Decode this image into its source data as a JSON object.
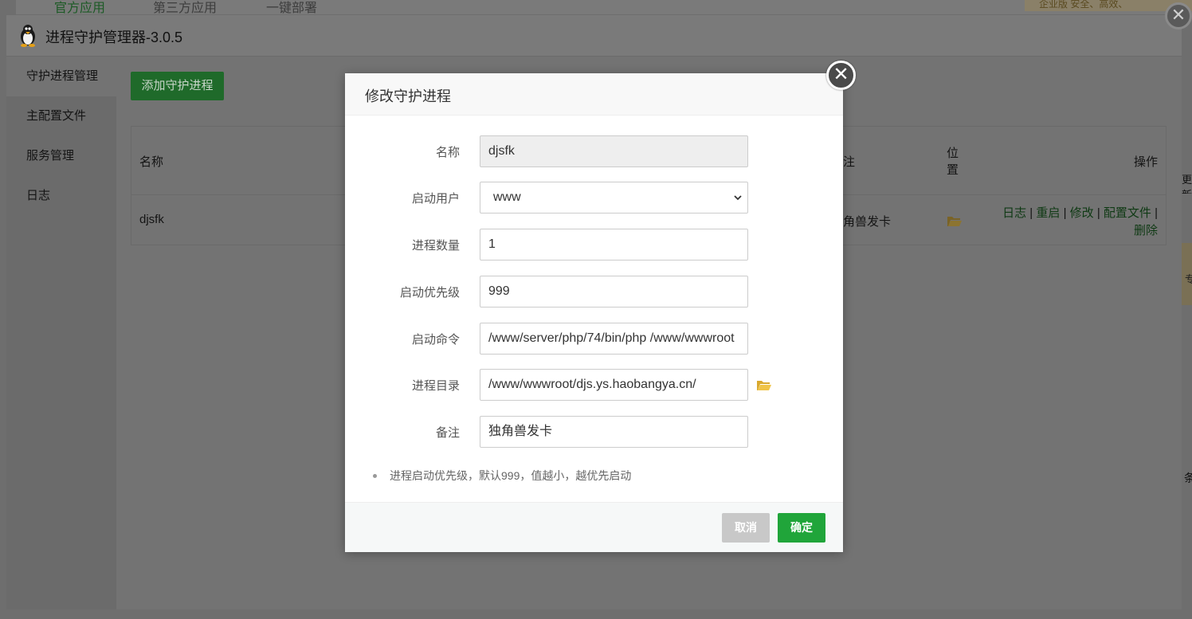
{
  "background_tabs": [
    "官方应用",
    "第三方应用",
    "一键部署"
  ],
  "background_badge": "企业版  安全、高效、",
  "window": {
    "title": "进程守护管理器-3.0.5",
    "close_glyph": "✕"
  },
  "sidebar": {
    "items": [
      {
        "label": "守护进程管理",
        "active": true
      },
      {
        "label": "主配置文件"
      },
      {
        "label": "服务管理"
      },
      {
        "label": "日志"
      }
    ]
  },
  "main": {
    "add_button": "添加守护进程",
    "table": {
      "headers": {
        "name": "名称",
        "note": "注",
        "location_line1": "位",
        "location_line2": "置",
        "actions": "操作"
      },
      "rows": [
        {
          "name": "djsfk",
          "note": "角兽发卡",
          "actions": [
            "日志",
            "重启",
            "修改",
            "配置文件",
            "删除"
          ],
          "separator": "|"
        }
      ]
    }
  },
  "edge_fragments": {
    "a": "更新",
    "b": "专",
    "c": "条"
  },
  "modal": {
    "title": "修改守护进程",
    "close_glyph": "✕",
    "fields": {
      "name": {
        "label": "名称",
        "value": "djsfk"
      },
      "user": {
        "label": "启动用户",
        "value": "www"
      },
      "count": {
        "label": "进程数量",
        "value": "1"
      },
      "priority": {
        "label": "启动优先级",
        "value": "999"
      },
      "command": {
        "label": "启动命令",
        "value": "/www/server/php/74/bin/php /www/wwwroot"
      },
      "directory": {
        "label": "进程目录",
        "value": "/www/wwwroot/djs.ys.haobangya.cn/"
      },
      "note": {
        "label": "备注",
        "value": "独角兽发卡"
      }
    },
    "tip": "进程启动优先级，默认999，值越小，越优先启动",
    "cancel_label": "取消",
    "ok_label": "确定"
  },
  "colors": {
    "accent_green": "#20a53a",
    "link_green": "#20a53a",
    "folder_yellow": "#e8b73a"
  }
}
